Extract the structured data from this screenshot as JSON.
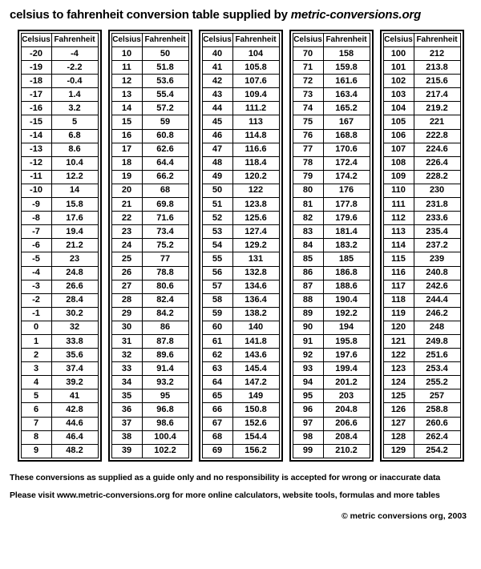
{
  "title_prefix": "celsius to fahrenheit conversion table supplied by ",
  "title_source": "metric-conversions.org",
  "headers": {
    "celsius": "Celsius",
    "fahrenheit": "Fahrenheit"
  },
  "columns": [
    {
      "start": -20,
      "rows": [
        {
          "c": "-20",
          "f": "-4"
        },
        {
          "c": "-19",
          "f": "-2.2"
        },
        {
          "c": "-18",
          "f": "-0.4"
        },
        {
          "c": "-17",
          "f": "1.4"
        },
        {
          "c": "-16",
          "f": "3.2"
        },
        {
          "c": "-15",
          "f": "5"
        },
        {
          "c": "-14",
          "f": "6.8"
        },
        {
          "c": "-13",
          "f": "8.6"
        },
        {
          "c": "-12",
          "f": "10.4"
        },
        {
          "c": "-11",
          "f": "12.2"
        },
        {
          "c": "-10",
          "f": "14"
        },
        {
          "c": "-9",
          "f": "15.8"
        },
        {
          "c": "-8",
          "f": "17.6"
        },
        {
          "c": "-7",
          "f": "19.4"
        },
        {
          "c": "-6",
          "f": "21.2"
        },
        {
          "c": "-5",
          "f": "23"
        },
        {
          "c": "-4",
          "f": "24.8"
        },
        {
          "c": "-3",
          "f": "26.6"
        },
        {
          "c": "-2",
          "f": "28.4"
        },
        {
          "c": "-1",
          "f": "30.2"
        },
        {
          "c": "0",
          "f": "32"
        },
        {
          "c": "1",
          "f": "33.8"
        },
        {
          "c": "2",
          "f": "35.6"
        },
        {
          "c": "3",
          "f": "37.4"
        },
        {
          "c": "4",
          "f": "39.2"
        },
        {
          "c": "5",
          "f": "41"
        },
        {
          "c": "6",
          "f": "42.8"
        },
        {
          "c": "7",
          "f": "44.6"
        },
        {
          "c": "8",
          "f": "46.4"
        },
        {
          "c": "9",
          "f": "48.2"
        }
      ]
    },
    {
      "start": 10,
      "rows": [
        {
          "c": "10",
          "f": "50"
        },
        {
          "c": "11",
          "f": "51.8"
        },
        {
          "c": "12",
          "f": "53.6"
        },
        {
          "c": "13",
          "f": "55.4"
        },
        {
          "c": "14",
          "f": "57.2"
        },
        {
          "c": "15",
          "f": "59"
        },
        {
          "c": "16",
          "f": "60.8"
        },
        {
          "c": "17",
          "f": "62.6"
        },
        {
          "c": "18",
          "f": "64.4"
        },
        {
          "c": "19",
          "f": "66.2"
        },
        {
          "c": "20",
          "f": "68"
        },
        {
          "c": "21",
          "f": "69.8"
        },
        {
          "c": "22",
          "f": "71.6"
        },
        {
          "c": "23",
          "f": "73.4"
        },
        {
          "c": "24",
          "f": "75.2"
        },
        {
          "c": "25",
          "f": "77"
        },
        {
          "c": "26",
          "f": "78.8"
        },
        {
          "c": "27",
          "f": "80.6"
        },
        {
          "c": "28",
          "f": "82.4"
        },
        {
          "c": "29",
          "f": "84.2"
        },
        {
          "c": "30",
          "f": "86"
        },
        {
          "c": "31",
          "f": "87.8"
        },
        {
          "c": "32",
          "f": "89.6"
        },
        {
          "c": "33",
          "f": "91.4"
        },
        {
          "c": "34",
          "f": "93.2"
        },
        {
          "c": "35",
          "f": "95"
        },
        {
          "c": "36",
          "f": "96.8"
        },
        {
          "c": "37",
          "f": "98.6"
        },
        {
          "c": "38",
          "f": "100.4"
        },
        {
          "c": "39",
          "f": "102.2"
        }
      ]
    },
    {
      "start": 40,
      "rows": [
        {
          "c": "40",
          "f": "104"
        },
        {
          "c": "41",
          "f": "105.8"
        },
        {
          "c": "42",
          "f": "107.6"
        },
        {
          "c": "43",
          "f": "109.4"
        },
        {
          "c": "44",
          "f": "111.2"
        },
        {
          "c": "45",
          "f": "113"
        },
        {
          "c": "46",
          "f": "114.8"
        },
        {
          "c": "47",
          "f": "116.6"
        },
        {
          "c": "48",
          "f": "118.4"
        },
        {
          "c": "49",
          "f": "120.2"
        },
        {
          "c": "50",
          "f": "122"
        },
        {
          "c": "51",
          "f": "123.8"
        },
        {
          "c": "52",
          "f": "125.6"
        },
        {
          "c": "53",
          "f": "127.4"
        },
        {
          "c": "54",
          "f": "129.2"
        },
        {
          "c": "55",
          "f": "131"
        },
        {
          "c": "56",
          "f": "132.8"
        },
        {
          "c": "57",
          "f": "134.6"
        },
        {
          "c": "58",
          "f": "136.4"
        },
        {
          "c": "59",
          "f": "138.2"
        },
        {
          "c": "60",
          "f": "140"
        },
        {
          "c": "61",
          "f": "141.8"
        },
        {
          "c": "62",
          "f": "143.6"
        },
        {
          "c": "63",
          "f": "145.4"
        },
        {
          "c": "64",
          "f": "147.2"
        },
        {
          "c": "65",
          "f": "149"
        },
        {
          "c": "66",
          "f": "150.8"
        },
        {
          "c": "67",
          "f": "152.6"
        },
        {
          "c": "68",
          "f": "154.4"
        },
        {
          "c": "69",
          "f": "156.2"
        }
      ]
    },
    {
      "start": 70,
      "rows": [
        {
          "c": "70",
          "f": "158"
        },
        {
          "c": "71",
          "f": "159.8"
        },
        {
          "c": "72",
          "f": "161.6"
        },
        {
          "c": "73",
          "f": "163.4"
        },
        {
          "c": "74",
          "f": "165.2"
        },
        {
          "c": "75",
          "f": "167"
        },
        {
          "c": "76",
          "f": "168.8"
        },
        {
          "c": "77",
          "f": "170.6"
        },
        {
          "c": "78",
          "f": "172.4"
        },
        {
          "c": "79",
          "f": "174.2"
        },
        {
          "c": "80",
          "f": "176"
        },
        {
          "c": "81",
          "f": "177.8"
        },
        {
          "c": "82",
          "f": "179.6"
        },
        {
          "c": "83",
          "f": "181.4"
        },
        {
          "c": "84",
          "f": "183.2"
        },
        {
          "c": "85",
          "f": "185"
        },
        {
          "c": "86",
          "f": "186.8"
        },
        {
          "c": "87",
          "f": "188.6"
        },
        {
          "c": "88",
          "f": "190.4"
        },
        {
          "c": "89",
          "f": "192.2"
        },
        {
          "c": "90",
          "f": "194"
        },
        {
          "c": "91",
          "f": "195.8"
        },
        {
          "c": "92",
          "f": "197.6"
        },
        {
          "c": "93",
          "f": "199.4"
        },
        {
          "c": "94",
          "f": "201.2"
        },
        {
          "c": "95",
          "f": "203"
        },
        {
          "c": "96",
          "f": "204.8"
        },
        {
          "c": "97",
          "f": "206.6"
        },
        {
          "c": "98",
          "f": "208.4"
        },
        {
          "c": "99",
          "f": "210.2"
        }
      ]
    },
    {
      "start": 100,
      "rows": [
        {
          "c": "100",
          "f": "212"
        },
        {
          "c": "101",
          "f": "213.8"
        },
        {
          "c": "102",
          "f": "215.6"
        },
        {
          "c": "103",
          "f": "217.4"
        },
        {
          "c": "104",
          "f": "219.2"
        },
        {
          "c": "105",
          "f": "221"
        },
        {
          "c": "106",
          "f": "222.8"
        },
        {
          "c": "107",
          "f": "224.6"
        },
        {
          "c": "108",
          "f": "226.4"
        },
        {
          "c": "109",
          "f": "228.2"
        },
        {
          "c": "110",
          "f": "230"
        },
        {
          "c": "111",
          "f": "231.8"
        },
        {
          "c": "112",
          "f": "233.6"
        },
        {
          "c": "113",
          "f": "235.4"
        },
        {
          "c": "114",
          "f": "237.2"
        },
        {
          "c": "115",
          "f": "239"
        },
        {
          "c": "116",
          "f": "240.8"
        },
        {
          "c": "117",
          "f": "242.6"
        },
        {
          "c": "118",
          "f": "244.4"
        },
        {
          "c": "119",
          "f": "246.2"
        },
        {
          "c": "120",
          "f": "248"
        },
        {
          "c": "121",
          "f": "249.8"
        },
        {
          "c": "122",
          "f": "251.6"
        },
        {
          "c": "123",
          "f": "253.4"
        },
        {
          "c": "124",
          "f": "255.2"
        },
        {
          "c": "125",
          "f": "257"
        },
        {
          "c": "126",
          "f": "258.8"
        },
        {
          "c": "127",
          "f": "260.6"
        },
        {
          "c": "128",
          "f": "262.4"
        },
        {
          "c": "129",
          "f": "254.2"
        }
      ]
    }
  ],
  "disclaimer": "These conversions as supplied as a guide only and no responsibility is accepted for wrong or inaccurate data",
  "visit": "Please visit www.metric-conversions.org for more online calculators, website tools, formulas and more tables",
  "copyright": "© metric conversions org, 2003"
}
